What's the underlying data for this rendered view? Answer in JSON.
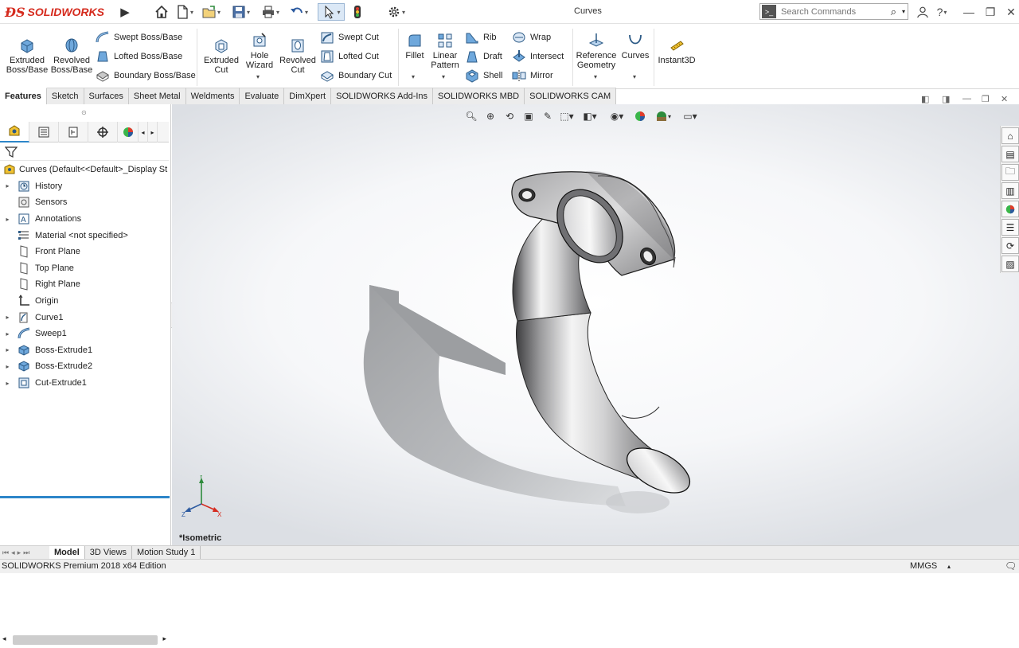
{
  "app": {
    "logo_text": "SOLIDWORKS",
    "document_title": "Curves"
  },
  "search": {
    "placeholder": "Search Commands"
  },
  "ribbon": {
    "extruded_boss": "Extruded Boss/Base",
    "revolved_boss": "Revolved Boss/Base",
    "swept_boss": "Swept Boss/Base",
    "lofted_boss": "Lofted Boss/Base",
    "boundary_boss": "Boundary Boss/Base",
    "extruded_cut": "Extruded Cut",
    "hole_wizard": "Hole Wizard",
    "revolved_cut": "Revolved Cut",
    "swept_cut": "Swept Cut",
    "lofted_cut": "Lofted Cut",
    "boundary_cut": "Boundary Cut",
    "fillet": "Fillet",
    "linear_pattern": "Linear Pattern",
    "rib": "Rib",
    "draft": "Draft",
    "shell": "Shell",
    "wrap": "Wrap",
    "intersect": "Intersect",
    "mirror": "Mirror",
    "reference_geometry": "Reference Geometry",
    "curves": "Curves",
    "instant3d": "Instant3D"
  },
  "command_tabs": [
    "Features",
    "Sketch",
    "Surfaces",
    "Sheet Metal",
    "Weldments",
    "Evaluate",
    "DimXpert",
    "SOLIDWORKS Add-Ins",
    "SOLIDWORKS MBD",
    "SOLIDWORKS CAM"
  ],
  "tree": {
    "root": "Curves  (Default<<Default>_Display St",
    "items": [
      {
        "label": "History",
        "expandable": true
      },
      {
        "label": "Sensors",
        "expandable": false
      },
      {
        "label": "Annotations",
        "expandable": true
      },
      {
        "label": "Material <not specified>",
        "expandable": false
      },
      {
        "label": "Front Plane",
        "expandable": false
      },
      {
        "label": "Top Plane",
        "expandable": false
      },
      {
        "label": "Right Plane",
        "expandable": false
      },
      {
        "label": "Origin",
        "expandable": false
      },
      {
        "label": "Curve1",
        "expandable": true
      },
      {
        "label": "Sweep1",
        "expandable": true
      },
      {
        "label": "Boss-Extrude1",
        "expandable": true
      },
      {
        "label": "Boss-Extrude2",
        "expandable": true
      },
      {
        "label": "Cut-Extrude1",
        "expandable": true
      }
    ]
  },
  "viewport": {
    "view_label": "*Isometric"
  },
  "bottom_tabs": [
    "Model",
    "3D Views",
    "Motion Study 1"
  ],
  "status": {
    "edition": "SOLIDWORKS Premium 2018 x64 Edition",
    "units": "MMGS"
  },
  "colors": {
    "accent": "#2d86c9",
    "brand": "#d52b1e"
  }
}
